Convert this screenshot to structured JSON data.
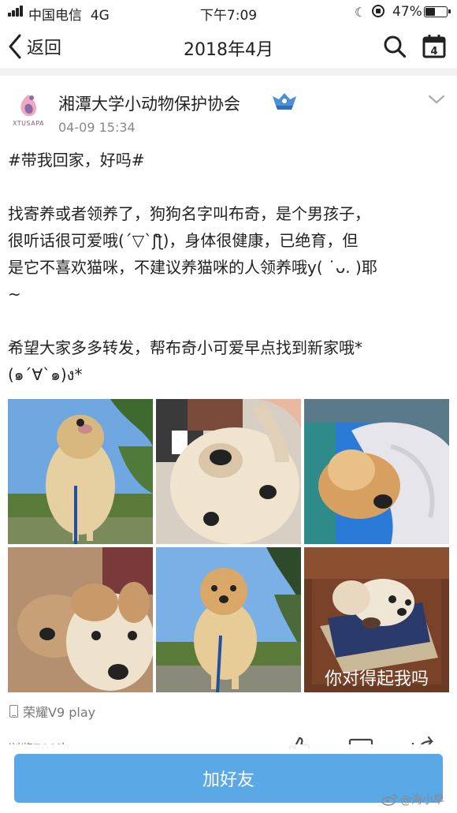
{
  "status_bar": {
    "carrier": "中国电信",
    "network": "4G",
    "time": "下午7:09",
    "battery_pct": "47%",
    "battery_level": 0.47
  },
  "nav": {
    "back_label": "返回",
    "title": "2018年4月",
    "calendar_day": "4"
  },
  "post": {
    "author": "湘潭大学小动物保护协会",
    "avatar_text": "XTUSAPA",
    "time": "04-09 15:34",
    "lines": [
      "#带我回家，好吗#",
      "",
      "找寄养或者领养了，狗狗名字叫布奇，是个男孩子，",
      "很听话很可爱哦(´▽`ʃƪ)，身体很健康，已绝育，但",
      "是它不喜欢猫咪，不建议养猫咪的人领养哦y( ˙ᴗ. )耶",
      "~",
      "",
      "希望大家多多转发，帮布奇小可爱早点找到新家哦*",
      "(๑´∀`๑)ง*"
    ],
    "photo_caption": "你对得起我吗",
    "device": "荣耀V9 play",
    "views": "浏览791次"
  },
  "bottom": {
    "add_friend_label": "加好友"
  },
  "watermark": "@海小早",
  "colors": {
    "button_blue": "#5aa8e6",
    "text": "#222222",
    "muted": "#888888"
  }
}
